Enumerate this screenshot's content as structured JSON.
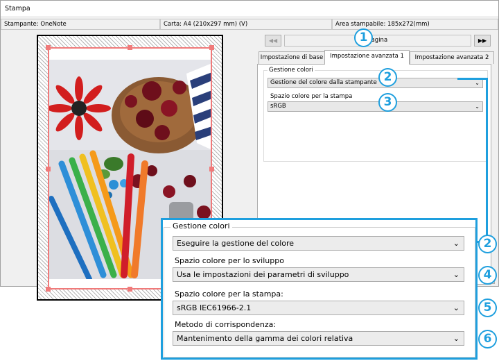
{
  "window": {
    "title": "Stampa",
    "printer_label": "Stampante: OneNote",
    "paper_label": "Carta: A4 (210x297 mm) (V)",
    "printable_area_label": "Area stampabile: 185x272(mm)"
  },
  "pager": {
    "prev_glyph": "◀◀",
    "next_glyph": "▶▶",
    "page_text": "Pagina"
  },
  "tabs": [
    {
      "label": "Impostazione di base"
    },
    {
      "label": "Impostazione avanzata 1"
    },
    {
      "label": "Impostazione avanzata 2"
    }
  ],
  "color_management": {
    "group_label": "Gestione colori",
    "mode_value": "Gestione del colore dalla stampante",
    "print_space_label": "Spazio colore per la stampa",
    "print_space_value": "sRGB"
  },
  "zoom_panel": {
    "group_label": "Gestione colori",
    "mode_value": "Eseguire la gestione del colore",
    "dev_space_label": "Spazio colore per lo sviluppo",
    "dev_space_value": "Usa le impostazioni dei parametri di sviluppo",
    "print_space_label": "Spazio colore per la stampa:",
    "print_space_value": "sRGB IEC61966-2.1",
    "intent_label": "Metodo di corrispondenza:",
    "intent_value": "Mantenimento della gamma dei colori relativa"
  },
  "callouts": {
    "c1": "1",
    "c2a": "2",
    "c3": "3",
    "c2b": "2",
    "c4": "4",
    "c5": "5",
    "c6": "6"
  },
  "icons": {
    "chevron": "⌄",
    "accent_color": "#1e9fde",
    "selection_color": "#f07a7a"
  }
}
